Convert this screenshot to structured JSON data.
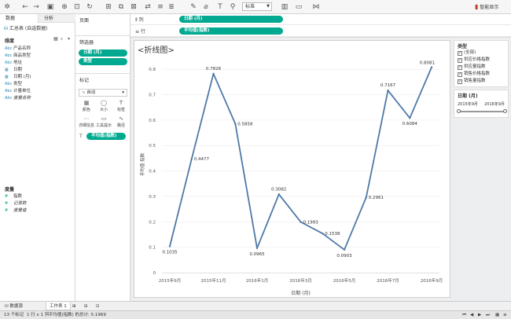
{
  "toolbar": {
    "view_select": "标准",
    "show_me": "智能显示"
  },
  "left_panel": {
    "tab_data": "数据",
    "tab_analysis": "分析",
    "datasource": "汇总表 (自选数据)",
    "dimensions_title": "维度",
    "dimension_fields": [
      {
        "type": "Abc",
        "name": "产品名称",
        "italic": false
      },
      {
        "type": "Abc",
        "name": "商品类型",
        "italic": false
      },
      {
        "type": "Abc",
        "name": "地址",
        "italic": false
      },
      {
        "type": "▦",
        "name": "日期",
        "italic": false
      },
      {
        "type": "▦",
        "name": "日期 (月)",
        "italic": false
      },
      {
        "type": "Abc",
        "name": "类型",
        "italic": false
      },
      {
        "type": "Abc",
        "name": "计量单位",
        "italic": false
      },
      {
        "type": "Abc",
        "name": "度量名称",
        "italic": true
      }
    ],
    "measures_title": "度量",
    "measure_fields": [
      {
        "type": "#",
        "name": "指数",
        "italic": false
      },
      {
        "type": "#",
        "name": "记录数",
        "italic": true
      },
      {
        "type": "#",
        "name": "度量值",
        "italic": true
      }
    ]
  },
  "cards": {
    "pages_title": "页面",
    "filters_title": "筛选器",
    "filter_pills": [
      "日期 (月)",
      "类型"
    ],
    "marks_title": "标记",
    "marks_type": "自动",
    "marks_buttons": [
      {
        "icon": "▦",
        "label": "颜色"
      },
      {
        "icon": "◯",
        "label": "大小"
      },
      {
        "icon": "T",
        "label": "标签"
      },
      {
        "icon": "⋯",
        "label": "详细信息"
      },
      {
        "icon": "▭",
        "label": "工具提示"
      },
      {
        "icon": "∿",
        "label": "路径"
      }
    ],
    "marks_pill": "平均值(指数)"
  },
  "shelves": {
    "columns_label": "列",
    "columns_pill": "日期 (月)",
    "rows_label": "行",
    "rows_pill": "平均值(指数)"
  },
  "chart_data": {
    "type": "line",
    "title": "<折线图>",
    "xlabel": "日期 (月)",
    "ylabel": "平均值 指数",
    "ylim": [
      0,
      0.85
    ],
    "yticks": [
      0.0,
      0.1,
      0.2,
      0.3,
      0.4,
      0.5,
      0.6,
      0.7,
      0.8
    ],
    "x_ticks": [
      "2015年9月",
      "2015年11月",
      "2016年1月",
      "2016年3月",
      "2016年5月",
      "2016年7月",
      "2016年9月"
    ],
    "x_tick_positions": [
      0,
      2,
      4,
      6,
      8,
      10,
      12
    ],
    "points": [
      {
        "x": 0,
        "value": 0.1035,
        "label": "0.1035"
      },
      {
        "x": 1,
        "value": 0.4477,
        "label": "0.4477"
      },
      {
        "x": 2,
        "value": 0.7826,
        "label": "0.7826"
      },
      {
        "x": 3,
        "value": 0.5858,
        "label": "0.5858"
      },
      {
        "x": 4,
        "value": 0.0965,
        "label": "0.0965"
      },
      {
        "x": 5,
        "value": 0.3082,
        "label": "0.3082"
      },
      {
        "x": 6,
        "value": 0.1993,
        "label": "0.1993"
      },
      {
        "x": 7,
        "value": 0.1538,
        "label": "0.1538"
      },
      {
        "x": 8,
        "value": 0.0903,
        "label": "0.0903"
      },
      {
        "x": 9,
        "value": 0.2961,
        "label": "0.2961"
      },
      {
        "x": 10,
        "value": 0.7167,
        "label": "0.7167"
      },
      {
        "x": 11,
        "value": 0.6084,
        "label": "0.6084"
      },
      {
        "x": 12,
        "value": 0.8081,
        "label": "0.8081"
      }
    ],
    "line_color": "#4e79a7",
    "grid": true
  },
  "right_panel": {
    "type_title": "类型",
    "type_options": [
      "(全部)",
      "供应价格指数",
      "供应量指数",
      "销售价格指数",
      "销售量指数"
    ],
    "date_title": "日期 (月)",
    "date_start": "2015年9月",
    "date_end": "2016年9月"
  },
  "bottom": {
    "datasource_tab": "数据源",
    "sheet_tab": "工作表 1"
  },
  "status": {
    "marks": "13 个标记",
    "rows_cols": "1 行 x 1 列",
    "sum": "平均值(指数) 的总计: 5.1969"
  }
}
